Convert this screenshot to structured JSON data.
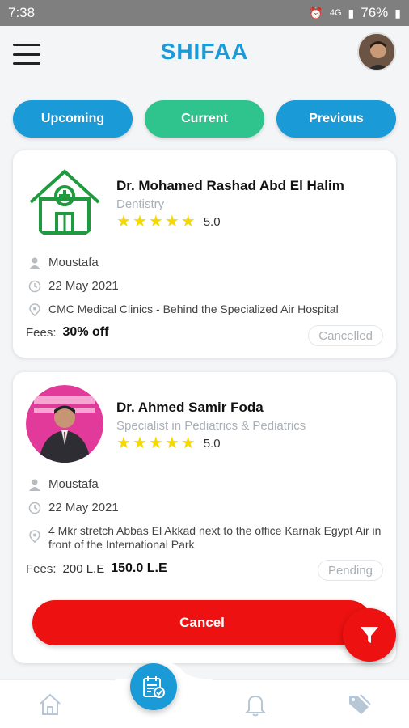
{
  "status_bar": {
    "time": "7:38",
    "battery": "76%",
    "network": "4G"
  },
  "app": {
    "logo": "SHIFAA"
  },
  "tabs": [
    {
      "label": "Upcoming",
      "color": "#1a9ad6"
    },
    {
      "label": "Current",
      "color": "#2fc48e"
    },
    {
      "label": "Previous",
      "color": "#1a9ad6"
    }
  ],
  "appointments": [
    {
      "doctor": "Dr. Mohamed Rashad Abd El Halim",
      "specialty": "Dentistry",
      "rating": "5.0",
      "stars": 5,
      "patient": "Moustafa",
      "date": "22 May 2021",
      "location": "CMC Medical Clinics - Behind the Specialized Air Hospital",
      "fees_label": "Fees:",
      "fees": "30% off",
      "status": "Cancelled"
    },
    {
      "doctor": "Dr. Ahmed Samir Foda",
      "specialty": "Specialist in Pediatrics & Pediatrics",
      "rating": "5.0",
      "stars": 5,
      "patient": "Moustafa",
      "date": "22 May 2021",
      "location": "4 Mkr stretch Abbas El Akkad next to the office Karnak Egypt Air in front of the International Park",
      "fees_label": "Fees:",
      "fees_old": "200 L.E",
      "fees": "150.0 L.E",
      "status": "Pending",
      "action": "Cancel"
    }
  ],
  "colors": {
    "primary": "#1a9ad6",
    "accent_green": "#2fc48e",
    "danger": "#ee1111",
    "star": "#f5d900"
  }
}
